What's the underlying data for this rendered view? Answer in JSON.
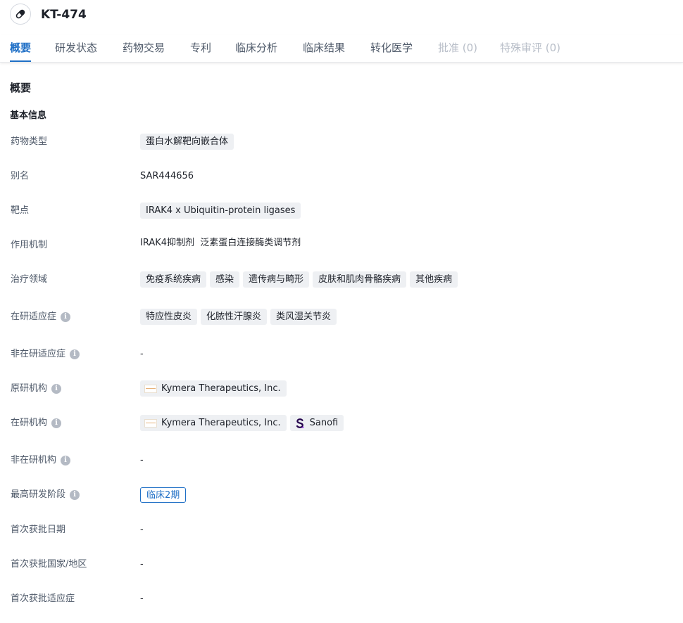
{
  "header": {
    "title": "KT-474",
    "icon": "pill-icon"
  },
  "tabs": [
    {
      "label": "概要",
      "state": "active"
    },
    {
      "label": "研发状态",
      "state": "normal"
    },
    {
      "label": "药物交易",
      "state": "normal"
    },
    {
      "label": "专利",
      "state": "normal"
    },
    {
      "label": "临床分析",
      "state": "normal"
    },
    {
      "label": "临床结果",
      "state": "normal"
    },
    {
      "label": "转化医学",
      "state": "normal"
    },
    {
      "label": "批准 (0)",
      "state": "disabled"
    },
    {
      "label": "特殊审评 (0)",
      "state": "disabled"
    }
  ],
  "section_title": "概要",
  "subsection_title": "基本信息",
  "info": {
    "drug_type": {
      "label": "药物类型",
      "tags": [
        "蛋白水解靶向嵌合体"
      ]
    },
    "alias": {
      "label": "别名",
      "value": "SAR444656"
    },
    "target": {
      "label": "靶点",
      "tags": [
        "IRAK4 x Ubiquitin-protein ligases"
      ]
    },
    "mechanism": {
      "label": "作用机制",
      "value": "IRAK4抑制剂  泛素蛋白连接酶类调节剂"
    },
    "therapeutic_area": {
      "label": "治疗领域",
      "tags": [
        "免疫系统疾病",
        "感染",
        "遗传病与畸形",
        "皮肤和肌肉骨骼疾病",
        "其他疾病"
      ]
    },
    "active_indications": {
      "label": "在研适应症",
      "tags": [
        "特应性皮炎",
        "化脓性汗腺炎",
        "类风湿关节炎"
      ]
    },
    "inactive_indications": {
      "label": "非在研适应症",
      "value": "-"
    },
    "originator": {
      "label": "原研机构",
      "orgs": [
        "Kymera Therapeutics, Inc."
      ]
    },
    "active_orgs": {
      "label": "在研机构",
      "orgs": [
        "Kymera Therapeutics, Inc.",
        "Sanofi"
      ]
    },
    "inactive_orgs": {
      "label": "非在研机构",
      "value": "-"
    },
    "highest_phase": {
      "label": "最高研发阶段",
      "phase": "临床2期"
    },
    "first_approval_date": {
      "label": "首次获批日期",
      "value": "-"
    },
    "first_approval_country": {
      "label": "首次获批国家/地区",
      "value": "-"
    },
    "first_approval_indication": {
      "label": "首次获批适应症",
      "value": "-"
    }
  },
  "colors": {
    "accent": "#1f6fc6",
    "tag_bg": "#eef0f3",
    "disabled": "#b8bec8"
  }
}
